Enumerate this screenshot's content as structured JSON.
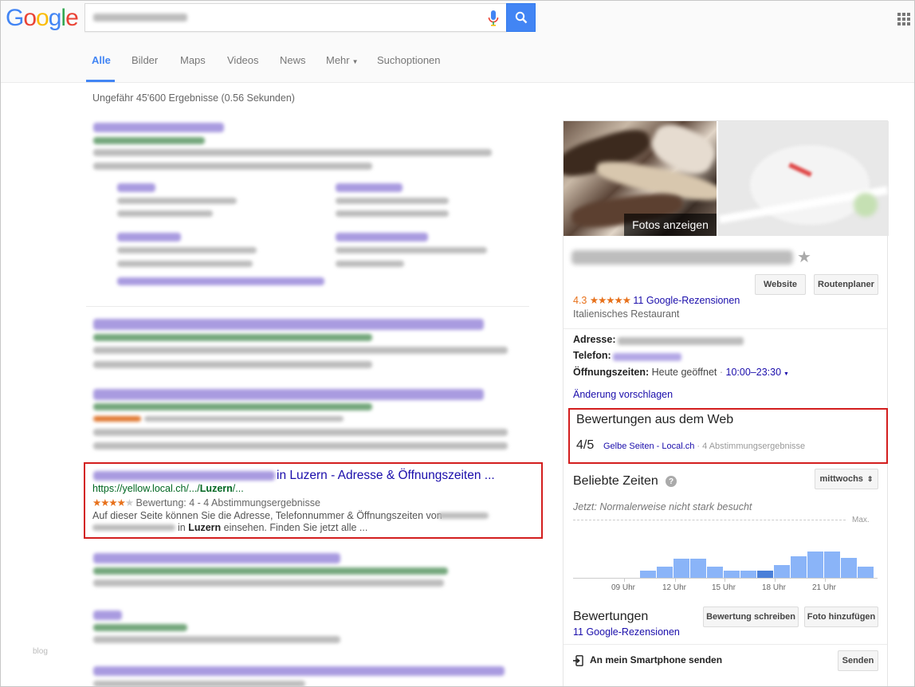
{
  "header": {
    "logo": [
      "G",
      "o",
      "o",
      "g",
      "l",
      "e"
    ],
    "logo_colors": [
      "#4285f4",
      "#ea4335",
      "#fbbc05",
      "#4285f4",
      "#34a853",
      "#ea4335"
    ],
    "search_button_color": "#4285f4"
  },
  "tabs": [
    {
      "label": "Alle",
      "active": true
    },
    {
      "label": "Bilder"
    },
    {
      "label": "Maps"
    },
    {
      "label": "Videos"
    },
    {
      "label": "News"
    },
    {
      "label": "Mehr"
    },
    {
      "label": "Suchoptionen"
    }
  ],
  "stats": "Ungefähr 45'600 Ergebnisse (0.56 Sekunden)",
  "highlighted_result": {
    "title": "in Luzern - Adresse & Öffnungszeiten ...",
    "url_prefix": "https://yellow.local.ch/.../",
    "url_bold": "Luzern",
    "url_suffix": "/...",
    "stars": "★★★★",
    "stars_off": "★",
    "rating_text": "Bewertung: 4 - 4 Abstimmungsergebnisse",
    "snippet_1": "Auf dieser Seite können Sie die Adresse, Telefonnummer & Öffnungszeiten von",
    "snippet_2_pre": "in ",
    "snippet_2_bold": "Luzern",
    "snippet_2_post": " einsehen. Finden Sie jetzt alle ..."
  },
  "watermark": "blog",
  "knowledge_panel": {
    "photo_label": "Fotos anzeigen",
    "website_button": "Website",
    "directions_button": "Routenplaner",
    "rating_value": "4.3",
    "rating_stars": "★★★★★",
    "reviews_link": "11 Google-Rezensionen",
    "type": "Italienisches Restaurant",
    "address_label": "Adresse:",
    "phone_label": "Telefon:",
    "hours_label": "Öffnungszeiten:",
    "hours_status": "Heute geöffnet",
    "hours_sep": " · ",
    "hours_time": "10:00–23:30",
    "suggest_edit": "Änderung vorschlagen",
    "web_reviews": {
      "title": "Bewertungen aus dem Web",
      "score": "4/5",
      "source": "Gelbe Seiten - Local.ch",
      "meta": " · 4 Abstimmungsergebnisse"
    },
    "popular_times": {
      "title": "Beliebte Zeiten",
      "help": "?",
      "day_select": "mittwochs",
      "now_text": "Jetzt: Normalerweise nicht stark besucht",
      "max_label": "Max.",
      "hours": [
        "09 Uhr",
        "12 Uhr",
        "15 Uhr",
        "18 Uhr",
        "21 Uhr"
      ],
      "bar_levels": [
        0,
        0,
        0,
        0,
        0.12,
        0.19,
        0.33,
        0.33,
        0.19,
        0.12,
        0.12,
        0.12,
        0.22,
        0.38,
        0.46,
        0.46,
        0.35,
        0.19
      ],
      "current_bar": 11
    },
    "reviews": {
      "title": "Bewertungen",
      "write_button": "Bewertung schreiben",
      "photo_button": "Foto hinzufügen",
      "link": "11 Google-Rezensionen"
    },
    "send": {
      "label": "An mein Smartphone senden",
      "button": "Senden"
    }
  }
}
